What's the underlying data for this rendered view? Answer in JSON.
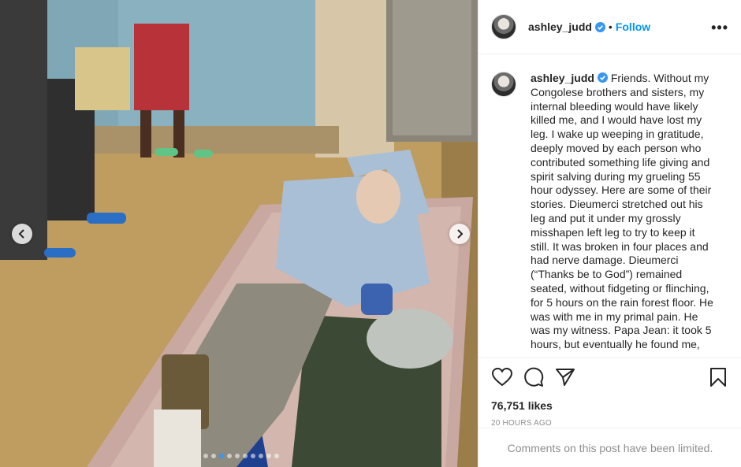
{
  "post": {
    "username": "ashley_judd",
    "separator": "•",
    "follow_label": "Follow",
    "more_label": "•••",
    "caption": "Friends. Without my Congolese brothers and sisters, my internal bleeding would have likely killed me, and I would have lost my leg. I wake up weeping in gratitude, deeply moved by each person who contributed something life giving and spirit salving during my grueling 55 hour odyssey. Here are some of their stories. Dieumerci stretched out his leg and put it under my grossly misshapen left leg to try to keep it still. It was broken in four places and had nerve damage. Dieumerci (“Thanks be to God”) remained seated, without fidgeting or flinching, for 5 hours on the rain forest floor. He was with me in my primal pain. He was my witness. Papa Jean: it took 5 hours, but eventually he found me,",
    "likes": "76,751 likes",
    "timestamp": "20 HOURS AGO",
    "comments_notice": "Comments on this post have been limited."
  },
  "carousel": {
    "dot_count": 10,
    "active_index": 2
  },
  "colors": {
    "accent": "#0095f6",
    "muted": "#8e8e8e",
    "verified": "#3897f0",
    "border": "#efefef"
  },
  "icons": {
    "prev": "chevron-left-icon",
    "next": "chevron-right-icon",
    "like": "heart-icon",
    "comment": "comment-icon",
    "share": "paper-plane-icon",
    "save": "bookmark-icon",
    "verified": "verified-badge-icon"
  }
}
